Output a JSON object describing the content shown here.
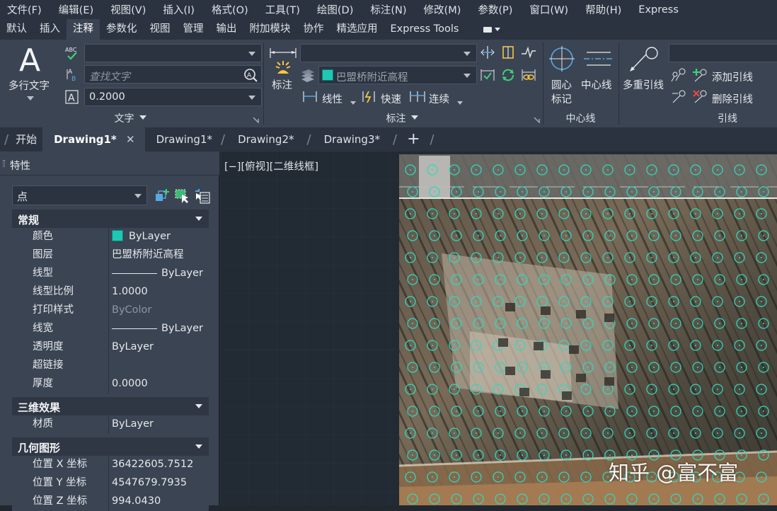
{
  "menubar": {
    "items": [
      "文件(F)",
      "编辑(E)",
      "视图(V)",
      "插入(I)",
      "格式(O)",
      "工具(T)",
      "绘图(D)",
      "标注(N)",
      "修改(M)",
      "参数(P)",
      "窗口(W)",
      "帮助(H)",
      "Express"
    ]
  },
  "ribbon_tabs": {
    "items": [
      "默认",
      "插入",
      "注释",
      "参数化",
      "视图",
      "管理",
      "输出",
      "附加模块",
      "协作",
      "精选应用",
      "Express Tools"
    ],
    "active": "注释"
  },
  "ribbon": {
    "text_panel": {
      "multiline_text_label": "多行文字",
      "find_text_placeholder": "查找文字",
      "text_height_value": "0.2000",
      "style_value": "",
      "title": "文字"
    },
    "dimension_panel": {
      "dimension_label": "标注",
      "dim_style_value": "",
      "layer_value": "巴盟桥附近高程",
      "linear_label": "线性",
      "quick_label": "快速",
      "continue_label": "连续",
      "title": "标注"
    },
    "centerline_panel": {
      "center_mark_label_line1": "圆心",
      "center_mark_label_line2": "标记",
      "centerline_label": "中心线",
      "title": "中心线"
    },
    "leader_panel": {
      "multileader_label": "多重引线",
      "add_leader_label": "添加引线",
      "remove_leader_label": "删除引线",
      "leader_style_value": "",
      "title": "引线"
    },
    "accent_color": "#1fc8b4"
  },
  "doc_tabs": {
    "items": [
      "开始",
      "Drawing1*",
      "Drawing1*",
      "Drawing2*",
      "Drawing3*"
    ],
    "active_index": 1,
    "add_symbol": "+",
    "close_symbol": "✕"
  },
  "properties": {
    "title": "特性",
    "object_type": "点",
    "sections": {
      "general": {
        "title": "常规",
        "rows": [
          {
            "key": "颜色",
            "value": "ByLayer"
          },
          {
            "key": "图层",
            "value": "巴盟桥附近高程"
          },
          {
            "key": "线型",
            "value": "ByLayer"
          },
          {
            "key": "线型比例",
            "value": "1.0000"
          },
          {
            "key": "打印样式",
            "value": "ByColor"
          },
          {
            "key": "线宽",
            "value": "ByLayer"
          },
          {
            "key": "透明度",
            "value": "ByLayer"
          },
          {
            "key": "超链接",
            "value": ""
          },
          {
            "key": "厚度",
            "value": "0.0000"
          }
        ]
      },
      "three_d": {
        "title": "三维效果",
        "rows": [
          {
            "key": "材质",
            "value": "ByLayer"
          }
        ]
      },
      "geometry": {
        "title": "几何图形",
        "rows": [
          {
            "key": "位置 X 坐标",
            "value": "36422605.7512"
          },
          {
            "key": "位置 Y 坐标",
            "value": "4547679.7935"
          },
          {
            "key": "位置 Z 坐标",
            "value": "994.0430"
          }
        ]
      }
    }
  },
  "viewport": {
    "label": "[−][俯视][二维线框]",
    "marker_color": "#2fd8c0"
  },
  "watermark": "知乎 @富不富"
}
